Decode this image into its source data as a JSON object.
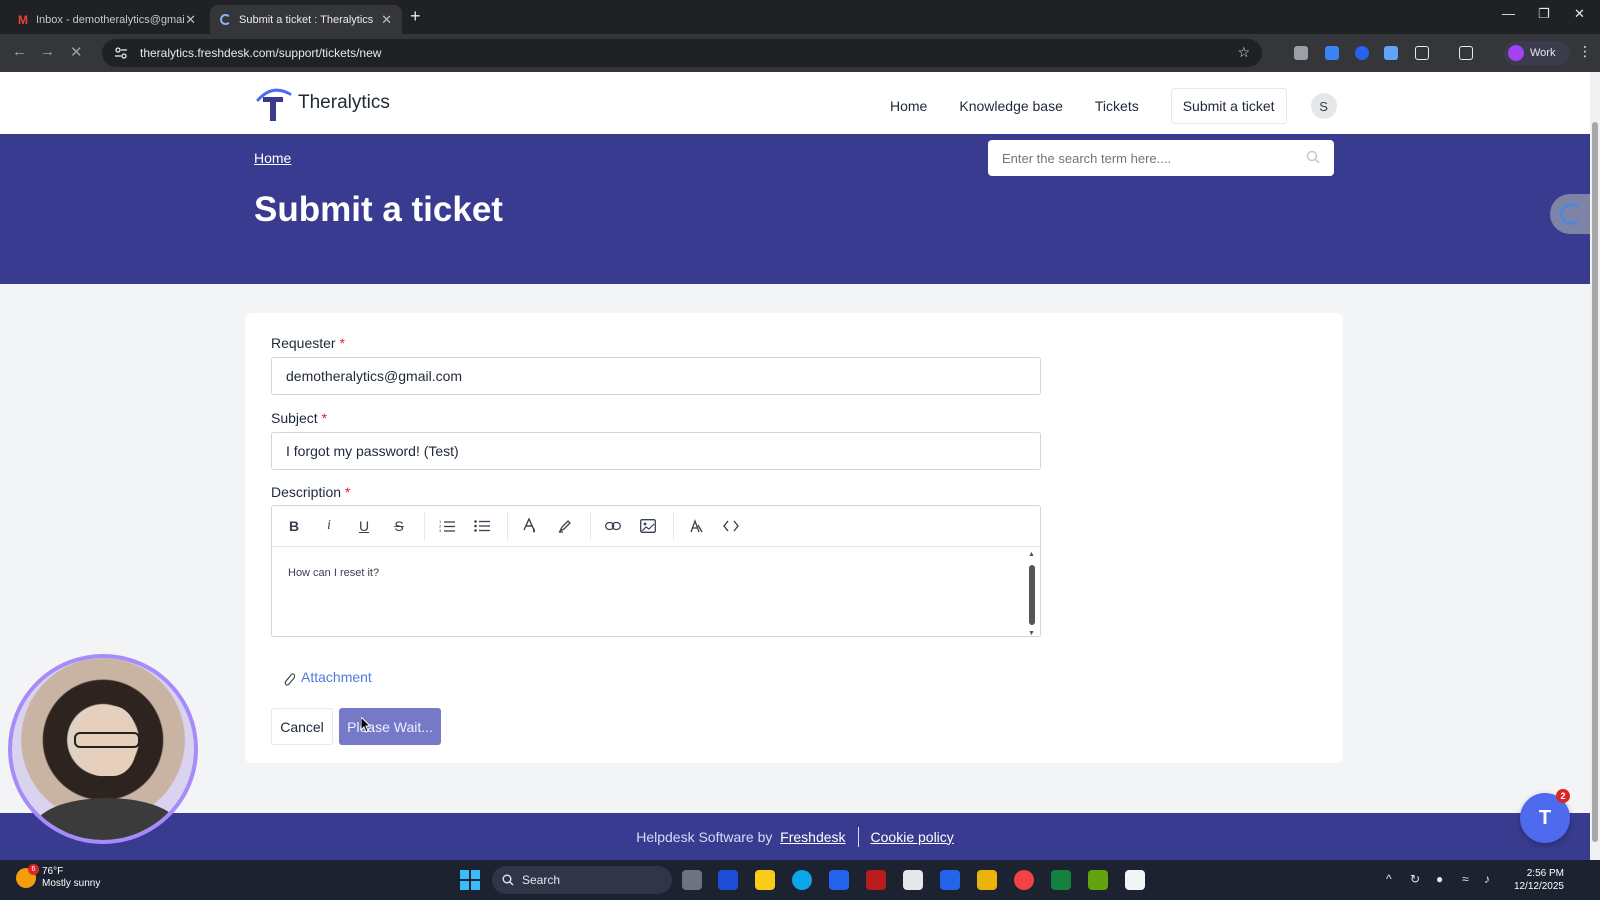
{
  "browser": {
    "tabs": [
      {
        "title": "Inbox - demotheralytics@gmail.com",
        "icon": "gmail-icon"
      },
      {
        "title": "Submit a ticket : Theralytics",
        "icon": "loading-spinner-icon"
      }
    ],
    "url": "theralytics.freshdesk.com/support/tickets/new",
    "profile_label": "Work"
  },
  "site": {
    "brand": "Theralytics",
    "nav": {
      "home": "Home",
      "knowledge_base": "Knowledge base",
      "tickets": "Tickets",
      "submit_ticket": "Submit a ticket",
      "user_initial": "S"
    }
  },
  "hero": {
    "breadcrumb": "Home",
    "title": "Submit a ticket",
    "search_placeholder": "Enter the search term here...."
  },
  "form": {
    "requester": {
      "label": "Requester",
      "required": "*",
      "value": "demotheralytics@gmail.com"
    },
    "subject": {
      "label": "Subject",
      "required": "*",
      "value": "I forgot my password! (Test)"
    },
    "description": {
      "label": "Description",
      "required": "*",
      "value": "How can I reset it?"
    },
    "attachment_label": "Attachment",
    "cancel_label": "Cancel",
    "submit_label": "Please Wait..."
  },
  "footer": {
    "text": "Helpdesk Software by",
    "link": "Freshdesk",
    "cookie": "Cookie policy"
  },
  "help_widget": {
    "badge": "2"
  },
  "taskbar": {
    "weather_temp": "76°F",
    "weather_desc": "Mostly sunny",
    "weather_badge": "6",
    "search_label": "Search",
    "time": "2:56 PM",
    "date": "12/12/2025"
  },
  "colors": {
    "brand": "#383b8f",
    "accent": "#4f6bed",
    "required": "#dc2626"
  }
}
